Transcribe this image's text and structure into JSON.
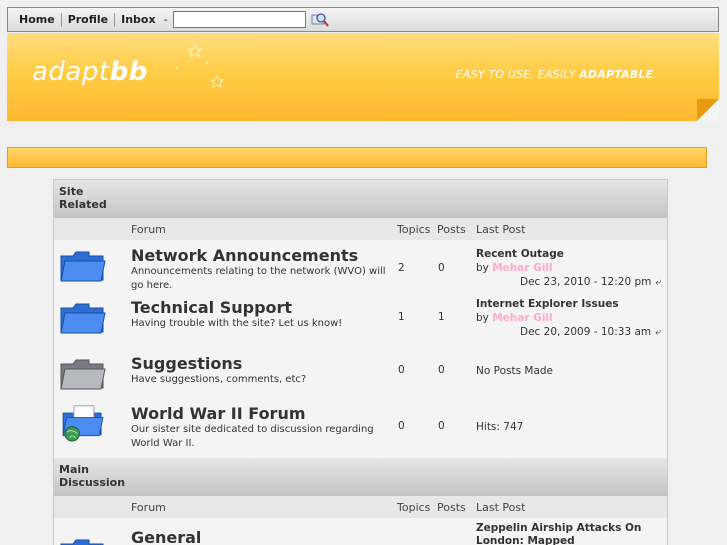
{
  "nav": {
    "home": "Home",
    "profile": "Profile",
    "inbox": "Inbox",
    "dash": "-",
    "search_value": ""
  },
  "banner": {
    "logo_light": "adapt",
    "logo_bold": "bb",
    "tagline_light": "EASY TO USE, EASILY ",
    "tagline_bold": "ADAPTABLE",
    "tagline_end": "."
  },
  "columns": {
    "forum": "Forum",
    "topics": "Topics",
    "posts": "Posts",
    "last_post": "Last Post"
  },
  "categories": [
    {
      "name": "Site Related",
      "forums": [
        {
          "title": "Network Announcements",
          "description": "Announcements relating to the network (WVO) will go here.",
          "topics": "2",
          "posts": "0",
          "last_title": "Recent Outage",
          "by": "by",
          "user": "Mehar Gill",
          "date": "Dec 23, 2010 - 12:20 pm",
          "icon": "folder-blue-icon"
        },
        {
          "title": "Technical Support",
          "description": "Having trouble with the site? Let us know!",
          "topics": "1",
          "posts": "1",
          "last_title": "Internet Explorer Issues",
          "by": "by",
          "user": "Mehar Gill",
          "date": "Dec 20, 2009 - 10:33 am",
          "icon": "folder-blue-icon"
        },
        {
          "title": "Suggestions",
          "description": "Have suggestions, comments, etc?",
          "topics": "0",
          "posts": "0",
          "last_text": "No Posts Made",
          "icon": "folder-gray-icon"
        },
        {
          "title": "World War II Forum",
          "description": "Our sister site dedicated to discussion regarding World War II.",
          "topics": "0",
          "posts": "0",
          "last_text": "Hits: 747",
          "icon": "folder-globe-icon"
        }
      ]
    },
    {
      "name": "Main Discussion",
      "forums": [
        {
          "title": "General",
          "topics": "",
          "posts": "",
          "last_title": "Zeppelin Airship Attacks On London: Mapped",
          "icon": "folder-blue-icon"
        }
      ]
    }
  ],
  "colors": {
    "banner": "#ffcc44",
    "user_link": "#ffaacc"
  }
}
